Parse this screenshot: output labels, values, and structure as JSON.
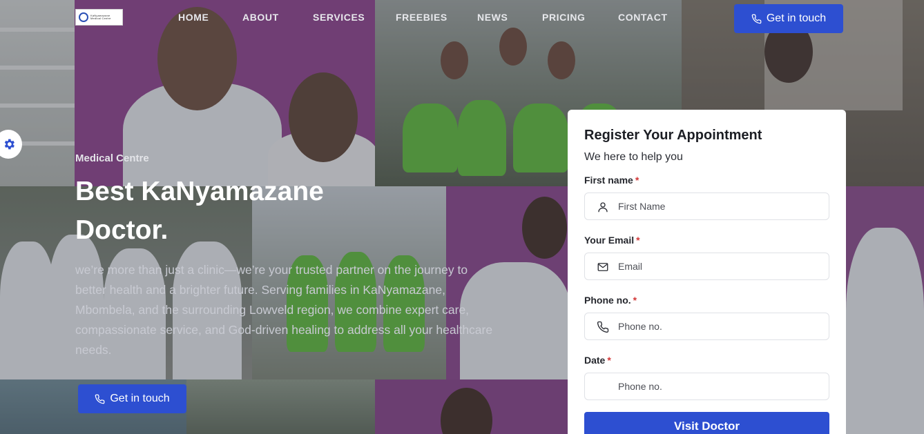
{
  "header": {
    "logo_text": "KaNyamazane Medical Centre",
    "nav": [
      "HOME",
      "ABOUT",
      "SERVICES",
      "FREEBIES",
      "NEWS",
      "PRICING",
      "CONTACT"
    ],
    "cta_label": "Get in touch"
  },
  "hero": {
    "eyebrow": "Medical Centre",
    "title": "Best KaNyamazane Doctor.",
    "text": "we’re more than just a clinic—we’re your trusted partner on the journey to better health and a brighter future. Serving families in KaNyamazane, Mbombela, and the surrounding Lowveld region, we combine expert care, compassionate service, and God-driven healing to address all your healthcare needs.",
    "cta_label": "Get in touch"
  },
  "form": {
    "title": "Register Your Appointment",
    "subtitle": "We here to help you",
    "fields": [
      {
        "label": "First name",
        "placeholder": "First Name",
        "icon": "user-icon",
        "value": ""
      },
      {
        "label": "Your Email",
        "placeholder": "Email",
        "icon": "mail-icon",
        "value": ""
      },
      {
        "label": "Phone no.",
        "placeholder": "Phone no.",
        "icon": "phone-icon",
        "value": ""
      },
      {
        "label": "Date",
        "placeholder": "Phone no.",
        "icon": "",
        "value": ""
      }
    ],
    "required_mark": "*",
    "submit_label": "Visit Doctor"
  },
  "theme": {
    "accent": "#2d4fd1",
    "required": "#d33838",
    "tile_purple": "#8e3d8c"
  },
  "icons": {
    "settings": "gear-icon",
    "cta": "phone-icon"
  }
}
